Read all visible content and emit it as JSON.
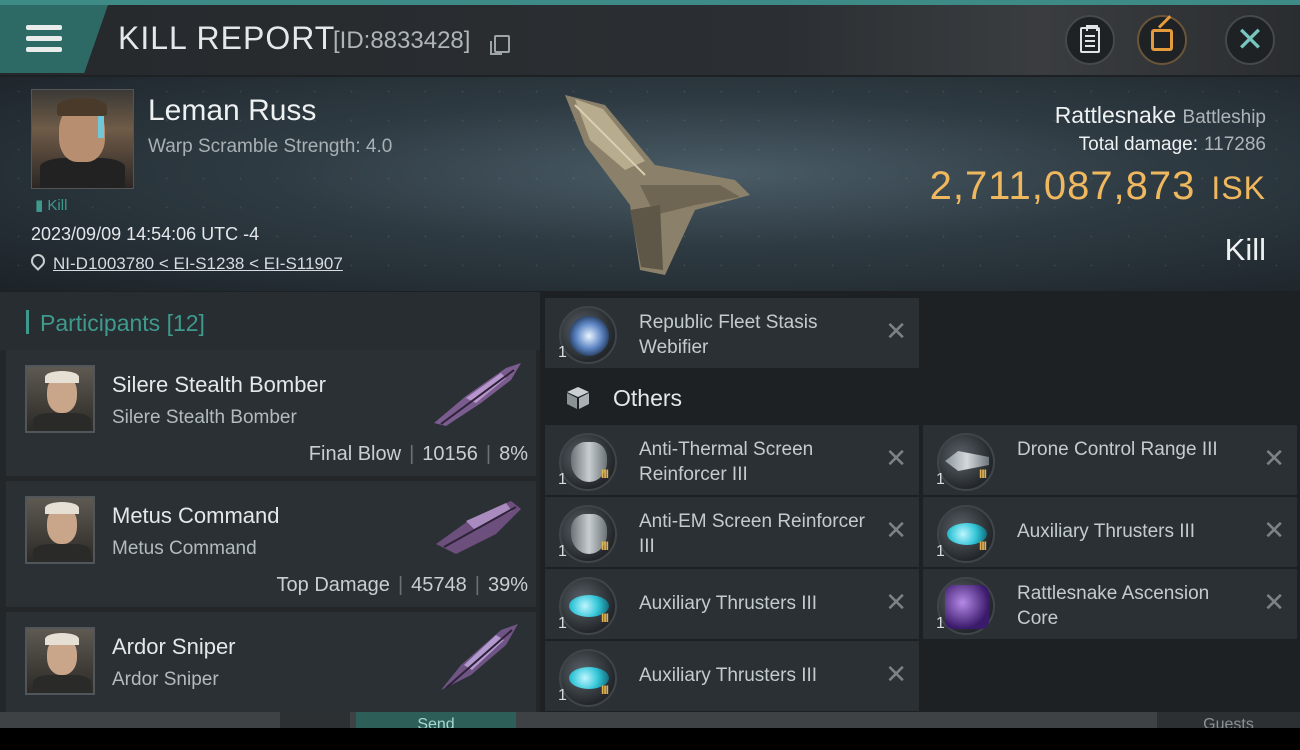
{
  "header": {
    "title": "KILL REPORT",
    "report_id": "[ID:8833428]"
  },
  "victim": {
    "pilot_name": "Leman Russ",
    "warp_scramble": "Warp Scramble Strength: 4.0",
    "status_tag": "Kill",
    "datetime": "2023/09/09 14:54:06 UTC -4",
    "location": "NI-D1003780 < EI-S1238 < EI-S11907",
    "ship_name": "Rattlesnake",
    "ship_class": "Battleship",
    "total_damage_label": "Total damage:",
    "total_damage": "117286",
    "isk_value": "2,711,087,873",
    "isk_unit": "ISK",
    "result": "Kill"
  },
  "participants": {
    "title": "Participants",
    "count": "[12]",
    "rows": [
      {
        "name": "Silere Stealth Bomber",
        "ship": "Silere Stealth Bomber",
        "tag": "Final Blow",
        "damage": "10156",
        "pct": "8%"
      },
      {
        "name": "Metus Command",
        "ship": "Metus Command",
        "tag": "Top Damage",
        "damage": "45748",
        "pct": "39%"
      },
      {
        "name": "Ardor Sniper",
        "ship": "Ardor Sniper",
        "tag": "",
        "damage": "",
        "pct": ""
      }
    ]
  },
  "modules": {
    "top": {
      "label": "Republic Fleet Stasis Webifier",
      "qty": "1",
      "icon": "stasis-webifier-icon"
    },
    "others_title": "Others",
    "left": [
      {
        "label": "Anti-Thermal Screen Reinforcer III",
        "qty": "1",
        "level": "III",
        "icon": "shield-rig-icon"
      },
      {
        "label": "Anti-EM Screen Reinforcer III",
        "qty": "1",
        "level": "III",
        "icon": "shield-rig-icon"
      },
      {
        "label": "Auxiliary Thrusters III",
        "qty": "1",
        "level": "III",
        "icon": "thruster-rig-icon"
      },
      {
        "label": "Auxiliary Thrusters III",
        "qty": "1",
        "level": "III",
        "icon": "thruster-rig-icon"
      }
    ],
    "right": [
      {
        "label": "Drone Control Range III",
        "qty": "1",
        "level": "III",
        "icon": "drone-rig-icon"
      },
      {
        "label": "Auxiliary Thrusters III",
        "qty": "1",
        "level": "III",
        "icon": "thruster-rig-icon"
      },
      {
        "label": "Rattlesnake Ascension Core",
        "qty": "1",
        "level": "",
        "icon": "ascension-core-icon"
      }
    ],
    "remove_glyph": "✕"
  },
  "background_ui": {
    "send_label": "Send",
    "guests_label": "Guests"
  },
  "colors": {
    "accent": "#3f9a8e",
    "isk": "#f0b85e",
    "panel": "#2b3034"
  }
}
